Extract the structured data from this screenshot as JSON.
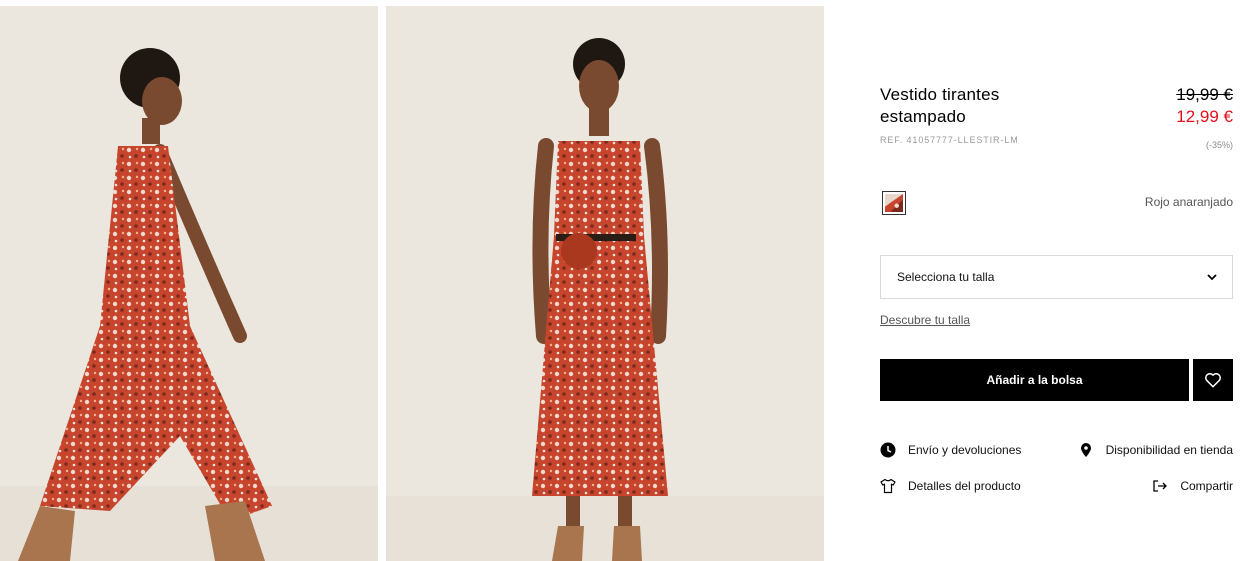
{
  "product": {
    "title": "Vestido tirantes estampado",
    "ref": "REF. 41057777-LLESTIR-LM",
    "old_price": "19,99 €",
    "new_price": "12,99 €",
    "discount": "(-35%)"
  },
  "color": {
    "name": "Rojo anaranjado",
    "swatch_icon": "print-swatch-icon"
  },
  "size": {
    "placeholder": "Selecciona tu talla",
    "discover_link": "Descubre tu talla"
  },
  "actions": {
    "add_to_bag": "Añadir a la bolsa",
    "favorite_icon": "heart-icon"
  },
  "info_links": {
    "shipping": "Envío y devoluciones",
    "availability": "Disponibilidad en tienda",
    "details": "Detalles del producto",
    "share": "Compartir"
  },
  "colors": {
    "accent_red": "#e3101e",
    "button_black": "#000000",
    "photo_bg": "#ece7de",
    "dress": "#c8452d"
  }
}
